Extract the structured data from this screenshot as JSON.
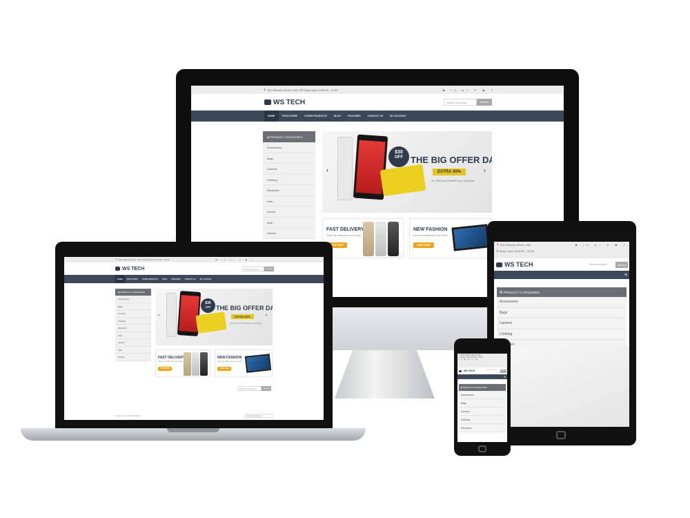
{
  "site": {
    "address": "202 Villavisa Street, USA",
    "hours": "Shops open at 08:00 - 22:30",
    "logo": "WS TECH",
    "search_placeholder": "Search products...",
    "search_button": "Search",
    "nav": [
      "HOME",
      "TECH STORE",
      "OTHER PRODUCTS",
      "BLOG",
      "FEATURES",
      "CONTACT US",
      "MY ACCOUNT"
    ],
    "categories_title": "PRODUCT CATEGORIES",
    "categories": [
      "Accessories",
      "Bags",
      "Camera",
      "Clothing",
      "Electronic",
      "Hats",
      "Interior",
      "Kids",
      "Kitchen"
    ],
    "slider": {
      "badge_price": "$30",
      "badge_off": "OFF",
      "headline": "THE BIG OFFER DAY",
      "extra": "EXTRA 30%",
      "subtitle": "On Selected SmartPhone and Ipad"
    },
    "promo1": {
      "title": "FAST DELIVERY",
      "desc": "Donec at mattis purus ac ornare",
      "button": "SHOP NOW"
    },
    "promo2": {
      "title": "NEW FASHION",
      "desc": "Donec at mattis purus ac ornare",
      "button": "SHOP NOW"
    },
    "sort_label": "Default sorting",
    "footer_note": "Shopping in with WS theme"
  },
  "tablet": {
    "address": "202 Villavisa Street, USA",
    "hours": "Shops open at 08:00 - 22:30",
    "categories": [
      "Accessories",
      "Bags",
      "Camera",
      "Clothing",
      "Electronic"
    ]
  },
  "phone": {
    "address": "202 Villavisa Street, USA",
    "hours": "Shops open at 08:00 - 22:30",
    "categories": [
      "Accessories",
      "Bags",
      "Camera",
      "Clothing",
      "Electronic"
    ]
  },
  "colors": {
    "nav": "#3a4859",
    "accent": "#f0a218",
    "offer_yellow": "#e3c422"
  }
}
